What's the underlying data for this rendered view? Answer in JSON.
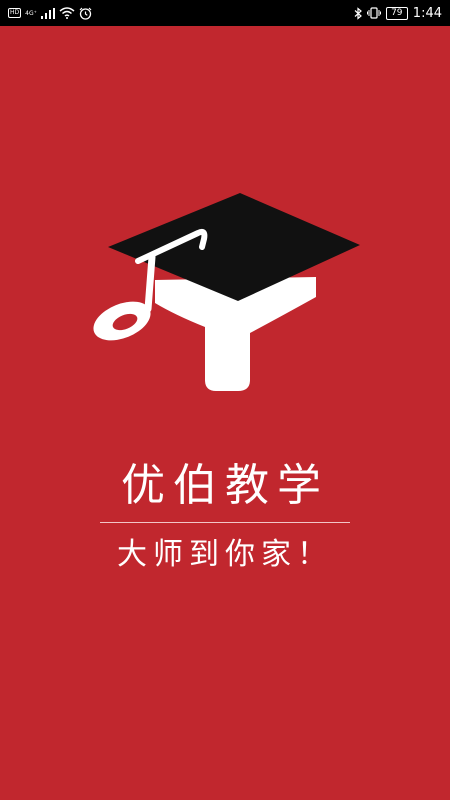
{
  "status_bar": {
    "hd_label": "HD",
    "network_label": "4G⁺",
    "battery_level": "79",
    "time": "1:44",
    "icons": {
      "signal": "cellular-signal-icon",
      "wifi": "wifi-icon",
      "alarm": "alarm-icon",
      "bluetooth": "bluetooth-icon",
      "vibrate": "vibrate-icon",
      "battery": "battery-icon"
    }
  },
  "splash": {
    "logo": "graduation-cap-music-note-logo",
    "title": "优伯教学",
    "slogan": "大师到你家！"
  },
  "colors": {
    "background": "#c1272e",
    "cap": "#111111",
    "logo_white": "#ffffff",
    "status_bar": "#000000"
  }
}
